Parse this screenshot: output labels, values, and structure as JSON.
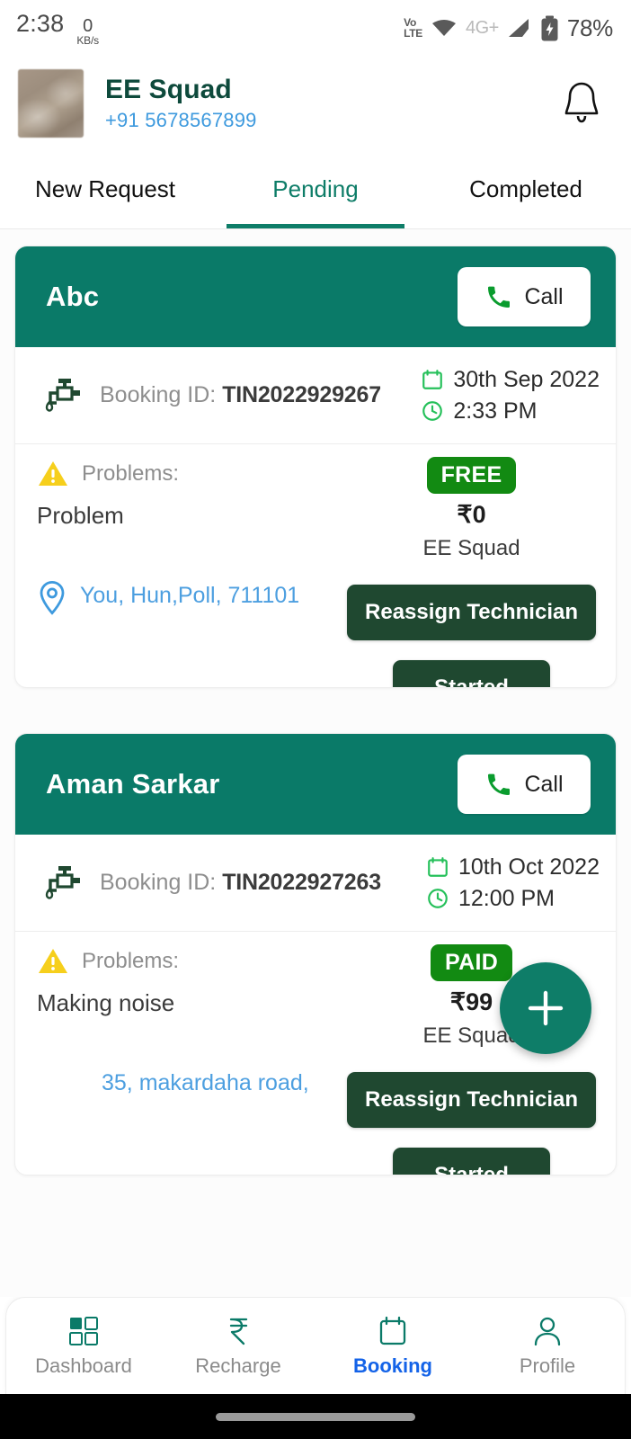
{
  "status_bar": {
    "time": "2:38",
    "net_speed_value": "0",
    "net_speed_unit": "KB/s",
    "volte_top": "Vo",
    "volte_bottom": "LTE",
    "network": "4G+",
    "battery": "78%"
  },
  "header": {
    "title": "EE Squad",
    "phone": "+91 5678567899",
    "avatar_name": "profile-photo",
    "bell_name": "notification-bell-icon"
  },
  "tabs": [
    {
      "label": "New Request",
      "active": false
    },
    {
      "label": "Pending",
      "active": true
    },
    {
      "label": "Completed",
      "active": false
    }
  ],
  "colors": {
    "teal": "#0a7a68",
    "tab_active": "#0e7d68",
    "dark_green_button": "#1f4830",
    "badge_green": "#128a12",
    "link_blue": "#4d9fe0",
    "phone_blue": "#3e9ade",
    "nav_active_blue": "#1463e8",
    "warning_yellow": "#f6cf1c"
  },
  "cards": [
    {
      "customer": "Abc",
      "call_label": "Call",
      "booking_prefix": "Booking ID: ",
      "booking_id": "TIN2022929267",
      "date": "30th Sep 2022",
      "time": "2:33 PM",
      "problems_label": "Problems:",
      "problem": "Problem",
      "payment_status": "FREE",
      "amount": "₹0",
      "vendor": "EE Squad",
      "reassign_label": "Reassign Technician",
      "status_label": "Started",
      "address": "You, Hun,Poll, 711101"
    },
    {
      "customer": "Aman Sarkar",
      "call_label": "Call",
      "booking_prefix": "Booking ID: ",
      "booking_id": "TIN2022927263",
      "date": "10th Oct 2022",
      "time": "12:00 PM",
      "problems_label": "Problems:",
      "problem": "Making noise",
      "payment_status": "PAID",
      "amount": "₹99",
      "vendor": "EE Squad",
      "reassign_label": "Reassign Technician",
      "status_label": "Started",
      "address": "35, makardaha road,"
    }
  ],
  "fab": {
    "label": "+",
    "name": "add-booking-fab"
  },
  "bottom_nav": [
    {
      "label": "Dashboard",
      "icon": "grid-icon",
      "active": false
    },
    {
      "label": "Recharge",
      "icon": "rupee-icon",
      "active": false
    },
    {
      "label": "Booking",
      "icon": "calendar-icon",
      "active": true
    },
    {
      "label": "Profile",
      "icon": "person-icon",
      "active": false
    }
  ]
}
